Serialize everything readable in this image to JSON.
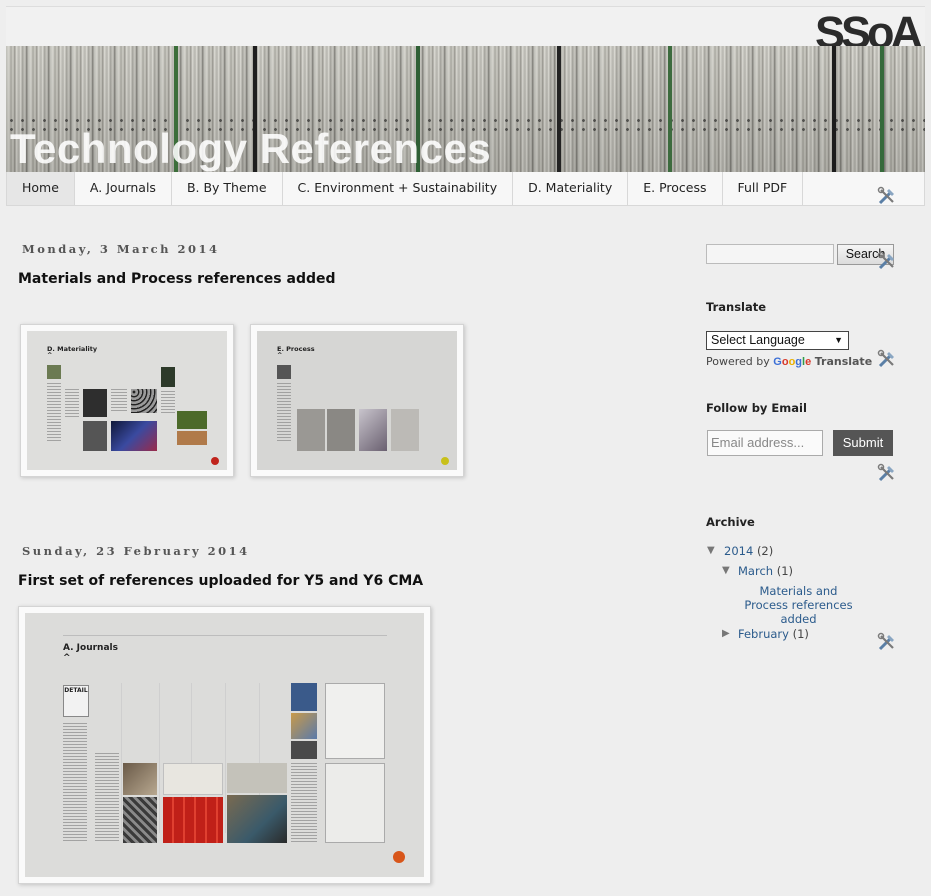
{
  "header": {
    "logo": "SSoA",
    "blog_title": "Technology References"
  },
  "nav": {
    "tabs": [
      {
        "label": "Home",
        "active": true
      },
      {
        "label": "A. Journals"
      },
      {
        "label": "B. By Theme"
      },
      {
        "label": "C. Environment + Sustainability"
      },
      {
        "label": "D. Materiality"
      },
      {
        "label": "E. Process"
      },
      {
        "label": "Full PDF"
      }
    ]
  },
  "posts": [
    {
      "date": "Monday, 3 March 2014",
      "title": "Materials and Process references added",
      "thumbs": [
        {
          "heading": "D. Materiality",
          "sub": "^",
          "dot_color": "#c0241c"
        },
        {
          "heading": "E. Process",
          "sub": "^",
          "dot_color": "#c8c01a"
        }
      ]
    },
    {
      "date": "Sunday, 23 February 2014",
      "title": "First set of references uploaded for Y5 and Y6 CMA",
      "image": {
        "heading": "A. Journals",
        "sub": "^",
        "logo": "DETAIL",
        "dot_color": "#d8561a"
      }
    }
  ],
  "sidebar": {
    "search_button": "Search",
    "translate_heading": "Translate",
    "select_language": "Select Language",
    "powered_by": "Powered by",
    "google": "Google",
    "translate": "Translate",
    "follow_heading": "Follow by Email",
    "email_placeholder": "Email address...",
    "submit": "Submit",
    "archive_heading": "Archive",
    "archive": {
      "year": "2014",
      "year_count": "(2)",
      "months": [
        {
          "name": "March",
          "count": "(1)",
          "posts": [
            "Materials and Process references added"
          ]
        },
        {
          "name": "February",
          "count": "(1)"
        }
      ]
    }
  },
  "colors": {
    "link": "#2b5b8c",
    "submit_bg": "#555555"
  }
}
